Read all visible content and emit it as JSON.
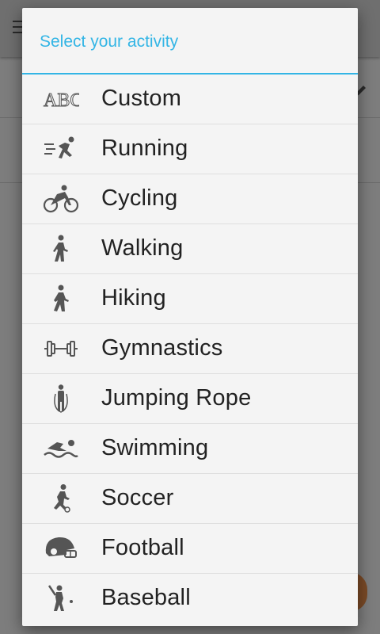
{
  "dialog": {
    "title": "Select your activity",
    "accent_color": "#33b5e5",
    "items": [
      {
        "label": "Custom",
        "icon": "abc-icon"
      },
      {
        "label": "Running",
        "icon": "running-icon"
      },
      {
        "label": "Cycling",
        "icon": "cycling-icon"
      },
      {
        "label": "Walking",
        "icon": "walking-icon"
      },
      {
        "label": "Hiking",
        "icon": "hiking-icon"
      },
      {
        "label": "Gymnastics",
        "icon": "dumbbell-icon"
      },
      {
        "label": "Jumping Rope",
        "icon": "jump-rope-icon"
      },
      {
        "label": "Swimming",
        "icon": "swimming-icon"
      },
      {
        "label": "Soccer",
        "icon": "soccer-icon"
      },
      {
        "label": "Football",
        "icon": "football-helmet-icon"
      },
      {
        "label": "Baseball",
        "icon": "baseball-icon"
      }
    ]
  }
}
